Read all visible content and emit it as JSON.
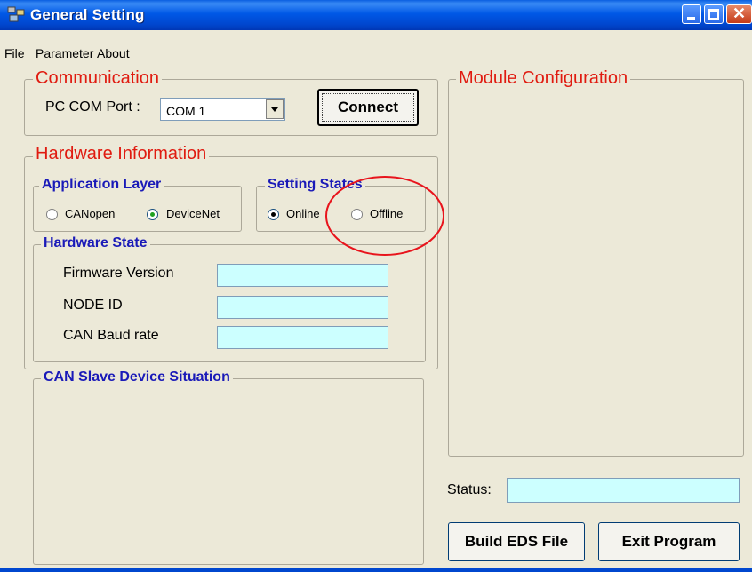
{
  "window": {
    "title": "General Setting"
  },
  "menu": [
    "File",
    "Parameter",
    "About"
  ],
  "communication": {
    "legend": "Communication",
    "port_label": "PC COM Port :",
    "port_value": "COM 1",
    "connect_label": "Connect"
  },
  "hardware": {
    "legend": "Hardware Information",
    "app_layer": {
      "legend": "Application Layer",
      "options": [
        "CANopen",
        "DeviceNet"
      ],
      "selected": "DeviceNet"
    },
    "setting_states": {
      "legend": "Setting States",
      "options": [
        "Online",
        "Offline"
      ],
      "selected": "Online"
    },
    "state": {
      "legend": "Hardware State",
      "fields": [
        {
          "label": "Firmware Version",
          "value": ""
        },
        {
          "label": "NODE ID",
          "value": ""
        },
        {
          "label": "CAN Baud rate",
          "value": ""
        }
      ]
    }
  },
  "slave": {
    "legend": "CAN Slave Device Situation"
  },
  "module": {
    "legend": "Module Configuration"
  },
  "status": {
    "label": "Status:",
    "value": ""
  },
  "buttons": {
    "build": "Build EDS File",
    "exit": "Exit Program"
  },
  "colors": {
    "field_bg": "#ccffff",
    "legend_red": "#e01b10",
    "legend_blue": "#1a1ab8",
    "annotation": "#e8141c"
  }
}
